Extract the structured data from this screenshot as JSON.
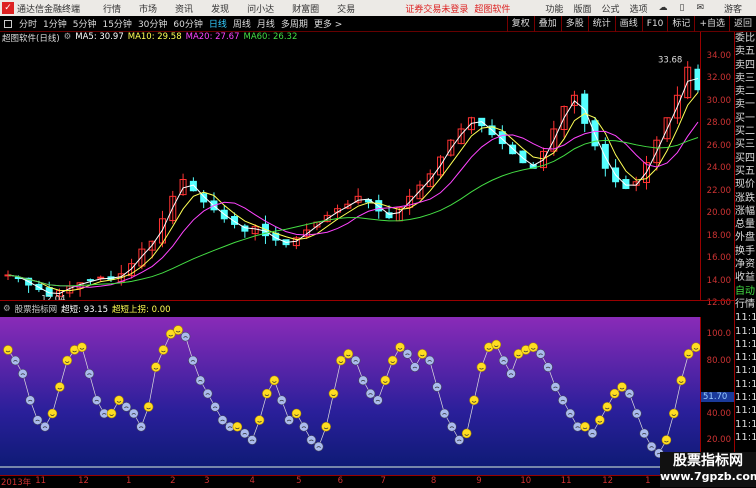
{
  "app": {
    "title": "通达信金融终端",
    "menus": [
      "行情",
      "市场",
      "资讯",
      "发现",
      "问小达",
      "财富圈",
      "交易"
    ],
    "login_status": "证券交易未登录",
    "brand": "超图软件",
    "right_menus": [
      "功能",
      "版面",
      "公式",
      "选项"
    ],
    "user": "游客"
  },
  "toolbar": {
    "periods": [
      "分时",
      "1分钟",
      "5分钟",
      "15分钟",
      "30分钟",
      "60分钟",
      "日线",
      "周线",
      "月线",
      "多周期",
      "更多 >"
    ],
    "active_period": "日线",
    "actions": [
      "复权",
      "叠加",
      "多股",
      "统计",
      "画线",
      "F10",
      "标记",
      "+自选",
      "返回"
    ]
  },
  "chart_header": {
    "name": "超图软件(日线)",
    "ma5": "MA5: 30.97",
    "ma10": "MA10: 29.58",
    "ma20": "MA20: 27.67",
    "ma60": "MA60: 26.32"
  },
  "colors": {
    "ma5": "#ffffff",
    "ma10": "#ffff55",
    "ma20": "#ff44ff",
    "ma60": "#44dd44",
    "up": "#ff3333",
    "down": "#55ffff",
    "axis": "#cc3333"
  },
  "chart_data": [
    {
      "type": "candlestick",
      "y_ticks": [
        "34.00",
        "32.00",
        "30.00",
        "28.00",
        "26.00",
        "24.00",
        "22.00",
        "20.00",
        "18.00",
        "16.00",
        "14.00",
        "12.00"
      ],
      "ylim": [
        12,
        34
      ],
      "closes": [
        14.5,
        14.2,
        13.6,
        13.2,
        12.6,
        13.1,
        13.5,
        13.8,
        14.0,
        14.3,
        14.1,
        14.6,
        15.5,
        16.8,
        17.5,
        19.5,
        21.5,
        23.0,
        22.0,
        21.0,
        20.3,
        19.5,
        19.0,
        18.4,
        18.8,
        18.0,
        17.6,
        17.2,
        17.8,
        18.5,
        19.2,
        19.8,
        20.4,
        20.8,
        21.5,
        21.0,
        20.2,
        19.6,
        20.5,
        21.5,
        22.5,
        23.5,
        25.0,
        26.5,
        27.5,
        28.5,
        27.8,
        27.0,
        26.2,
        25.3,
        24.5,
        24.0,
        25.5,
        27.5,
        29.5,
        30.5,
        28.0,
        26.0,
        24.0,
        22.8,
        22.2,
        22.8,
        24.5,
        26.5,
        28.5,
        30.5,
        33.0,
        31.0
      ],
      "high_label": "33.68",
      "low_label": "12.04"
    },
    {
      "type": "oscillator",
      "title": "股票指标网",
      "value_label": "超短: 93.15",
      "signal_label": "超短上拐: 0.00",
      "y_ticks": [
        "100.0",
        "80.00",
        "40.00",
        "20.00"
      ],
      "current": "51.70",
      "ylim": [
        0,
        110
      ],
      "values": [
        88,
        80,
        70,
        50,
        35,
        30,
        40,
        60,
        80,
        88,
        90,
        70,
        50,
        40,
        40,
        50,
        45,
        40,
        30,
        45,
        75,
        88,
        100,
        103,
        98,
        80,
        65,
        55,
        45,
        35,
        30,
        30,
        25,
        20,
        35,
        55,
        65,
        50,
        35,
        40,
        30,
        20,
        15,
        30,
        55,
        80,
        85,
        80,
        65,
        55,
        50,
        65,
        80,
        90,
        85,
        75,
        85,
        80,
        60,
        40,
        30,
        20,
        25,
        50,
        75,
        90,
        92,
        80,
        70,
        85,
        88,
        90,
        85,
        75,
        60,
        50,
        40,
        30,
        30,
        25,
        35,
        45,
        55,
        60,
        55,
        40,
        25,
        15,
        10,
        20,
        40,
        65,
        85,
        90
      ]
    }
  ],
  "dates": [
    "2013年",
    "11",
    "12",
    "1",
    "2",
    "3",
    "4",
    "5",
    "6",
    "7",
    "8",
    "9",
    "10",
    "11",
    "12",
    "1"
  ],
  "side_panel": [
    "委比",
    "卖五",
    "卖四",
    "卖三",
    "卖二",
    "卖一",
    "买一",
    "买二",
    "买三",
    "买四",
    "买五",
    "现价",
    "涨跌",
    "涨幅",
    "总量",
    "外盘",
    "换手",
    "净资",
    "收益",
    "自动",
    "行情",
    "11:19",
    "11:19",
    "11:19",
    "11:19",
    "11:19",
    "11:19",
    "11:19",
    "11:19",
    "11:19",
    "11:19"
  ],
  "watermark": {
    "name": "股票指标网",
    "url": "www.7gpzb.com"
  }
}
